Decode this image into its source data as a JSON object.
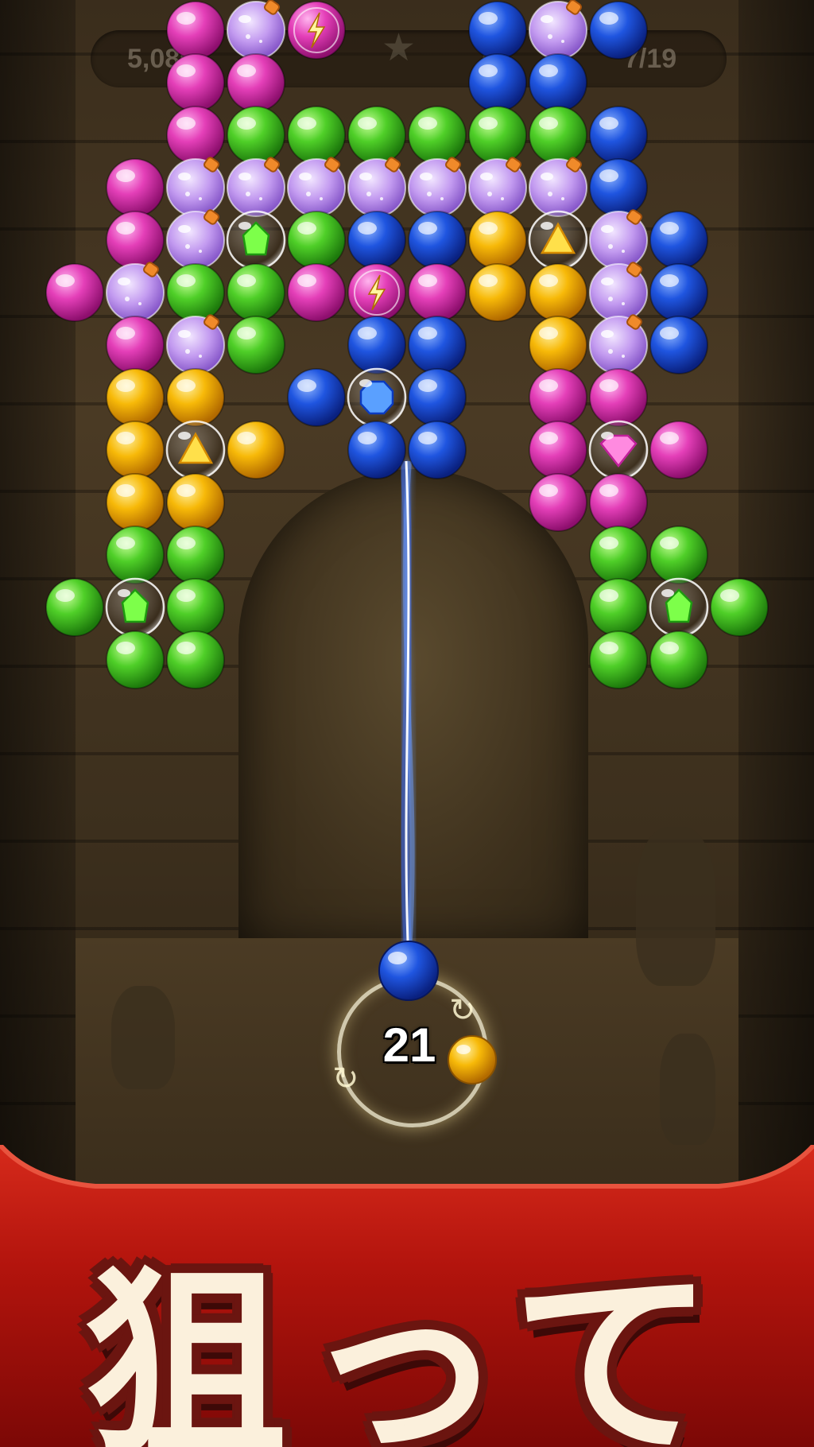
{
  "hud": {
    "score": "5,080",
    "progress": "7/19"
  },
  "shooter": {
    "shots_left": "21",
    "current_bubble": "blue",
    "next_bubble": "yellow"
  },
  "banner": {
    "text": "狙って"
  },
  "colors": {
    "pink": "#e43fb8",
    "green": "#4fcf28",
    "blue": "#1f55e0",
    "yellow": "#f7b908",
    "potion": "#c39bf0",
    "banner_red": "#b3140d",
    "banner_text": "#fbf0dc"
  },
  "board": {
    "bubbles": [
      {
        "row": 0,
        "col": 2,
        "type": "pink"
      },
      {
        "row": 0,
        "col": 3,
        "type": "potion"
      },
      {
        "row": 0,
        "col": 4,
        "type": "lightning"
      },
      {
        "row": 0,
        "col": 7,
        "type": "blue"
      },
      {
        "row": 0,
        "col": 8,
        "type": "potion"
      },
      {
        "row": 0,
        "col": 9,
        "type": "blue"
      },
      {
        "row": 1,
        "col": 2,
        "type": "pink"
      },
      {
        "row": 1,
        "col": 3,
        "type": "pink"
      },
      {
        "row": 1,
        "col": 7,
        "type": "blue"
      },
      {
        "row": 1,
        "col": 8,
        "type": "blue"
      },
      {
        "row": 2,
        "col": 2,
        "type": "pink"
      },
      {
        "row": 2,
        "col": 3,
        "type": "green"
      },
      {
        "row": 2,
        "col": 4,
        "type": "green"
      },
      {
        "row": 2,
        "col": 5,
        "type": "green"
      },
      {
        "row": 2,
        "col": 6,
        "type": "green"
      },
      {
        "row": 2,
        "col": 7,
        "type": "green"
      },
      {
        "row": 2,
        "col": 8,
        "type": "green"
      },
      {
        "row": 2,
        "col": 9,
        "type": "blue"
      },
      {
        "row": 3,
        "col": 1,
        "type": "pink"
      },
      {
        "row": 3,
        "col": 2,
        "type": "potion"
      },
      {
        "row": 3,
        "col": 3,
        "type": "potion"
      },
      {
        "row": 3,
        "col": 4,
        "type": "potion"
      },
      {
        "row": 3,
        "col": 5,
        "type": "potion"
      },
      {
        "row": 3,
        "col": 6,
        "type": "potion"
      },
      {
        "row": 3,
        "col": 7,
        "type": "potion"
      },
      {
        "row": 3,
        "col": 8,
        "type": "potion"
      },
      {
        "row": 3,
        "col": 9,
        "type": "blue"
      },
      {
        "row": 4,
        "col": 1,
        "type": "pink"
      },
      {
        "row": 4,
        "col": 2,
        "type": "potion"
      },
      {
        "row": 4,
        "col": 3,
        "type": "gem-green"
      },
      {
        "row": 4,
        "col": 4,
        "type": "green"
      },
      {
        "row": 4,
        "col": 5,
        "type": "blue"
      },
      {
        "row": 4,
        "col": 6,
        "type": "blue"
      },
      {
        "row": 4,
        "col": 7,
        "type": "yellow"
      },
      {
        "row": 4,
        "col": 8,
        "type": "gem-yellow"
      },
      {
        "row": 4,
        "col": 9,
        "type": "potion"
      },
      {
        "row": 4,
        "col": 10,
        "type": "blue"
      },
      {
        "row": 5,
        "col": 0,
        "type": "pink"
      },
      {
        "row": 5,
        "col": 1,
        "type": "potion"
      },
      {
        "row": 5,
        "col": 2,
        "type": "green"
      },
      {
        "row": 5,
        "col": 3,
        "type": "green"
      },
      {
        "row": 5,
        "col": 4,
        "type": "pink"
      },
      {
        "row": 5,
        "col": 5,
        "type": "lightning"
      },
      {
        "row": 5,
        "col": 6,
        "type": "pink"
      },
      {
        "row": 5,
        "col": 7,
        "type": "yellow"
      },
      {
        "row": 5,
        "col": 8,
        "type": "yellow"
      },
      {
        "row": 5,
        "col": 9,
        "type": "potion"
      },
      {
        "row": 5,
        "col": 10,
        "type": "blue"
      },
      {
        "row": 6,
        "col": 1,
        "type": "pink"
      },
      {
        "row": 6,
        "col": 2,
        "type": "potion"
      },
      {
        "row": 6,
        "col": 3,
        "type": "green"
      },
      {
        "row": 6,
        "col": 5,
        "type": "blue"
      },
      {
        "row": 6,
        "col": 6,
        "type": "blue"
      },
      {
        "row": 6,
        "col": 8,
        "type": "yellow"
      },
      {
        "row": 6,
        "col": 9,
        "type": "potion"
      },
      {
        "row": 6,
        "col": 10,
        "type": "blue"
      },
      {
        "row": 7,
        "col": 1,
        "type": "yellow"
      },
      {
        "row": 7,
        "col": 2,
        "type": "yellow"
      },
      {
        "row": 7,
        "col": 4,
        "type": "blue"
      },
      {
        "row": 7,
        "col": 5,
        "type": "gem-blue"
      },
      {
        "row": 7,
        "col": 6,
        "type": "blue"
      },
      {
        "row": 7,
        "col": 8,
        "type": "pink"
      },
      {
        "row": 7,
        "col": 9,
        "type": "pink"
      },
      {
        "row": 8,
        "col": 1,
        "type": "yellow"
      },
      {
        "row": 8,
        "col": 2,
        "type": "gem-yellow"
      },
      {
        "row": 8,
        "col": 3,
        "type": "yellow"
      },
      {
        "row": 8,
        "col": 5,
        "type": "blue"
      },
      {
        "row": 8,
        "col": 6,
        "type": "blue"
      },
      {
        "row": 8,
        "col": 8,
        "type": "pink"
      },
      {
        "row": 8,
        "col": 9,
        "type": "gem-pink"
      },
      {
        "row": 8,
        "col": 10,
        "type": "pink"
      },
      {
        "row": 9,
        "col": 1,
        "type": "yellow"
      },
      {
        "row": 9,
        "col": 2,
        "type": "yellow"
      },
      {
        "row": 9,
        "col": 8,
        "type": "pink"
      },
      {
        "row": 9,
        "col": 9,
        "type": "pink"
      },
      {
        "row": 10,
        "col": 1,
        "type": "green"
      },
      {
        "row": 10,
        "col": 2,
        "type": "green"
      },
      {
        "row": 10,
        "col": 9,
        "type": "green"
      },
      {
        "row": 10,
        "col": 10,
        "type": "green"
      },
      {
        "row": 11,
        "col": 0,
        "type": "green"
      },
      {
        "row": 11,
        "col": 1,
        "type": "gem-green"
      },
      {
        "row": 11,
        "col": 2,
        "type": "green"
      },
      {
        "row": 11,
        "col": 9,
        "type": "green"
      },
      {
        "row": 11,
        "col": 10,
        "type": "gem-green"
      },
      {
        "row": 11,
        "col": 11,
        "type": "green"
      },
      {
        "row": 12,
        "col": 1,
        "type": "green"
      },
      {
        "row": 12,
        "col": 2,
        "type": "green"
      },
      {
        "row": 12,
        "col": 9,
        "type": "green"
      },
      {
        "row": 12,
        "col": 10,
        "type": "green"
      }
    ]
  }
}
